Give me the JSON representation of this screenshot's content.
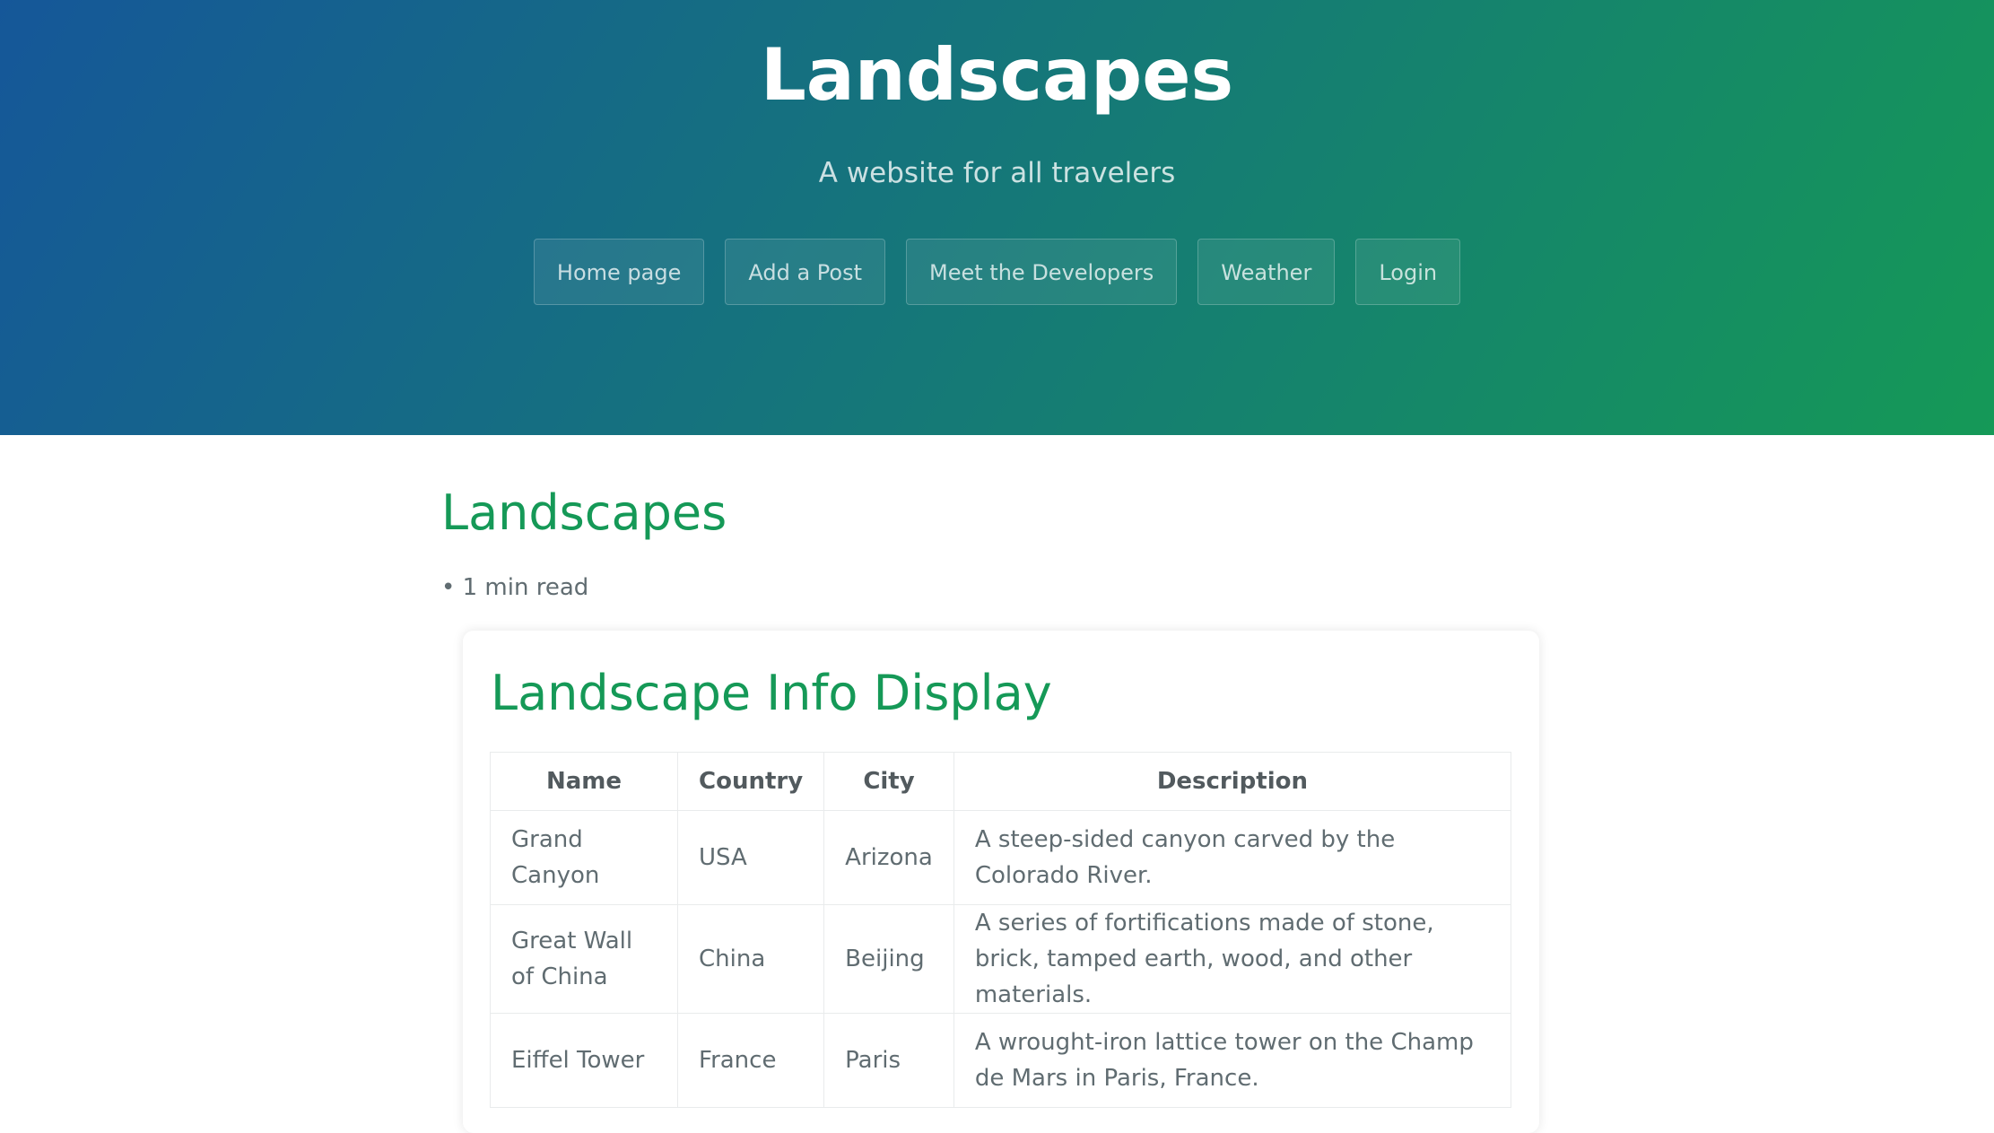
{
  "header": {
    "title": "Landscapes",
    "tagline": "A website for all travelers",
    "nav": [
      {
        "label": "Home page"
      },
      {
        "label": "Add a Post"
      },
      {
        "label": "Meet the Developers"
      },
      {
        "label": "Weather"
      },
      {
        "label": "Login"
      }
    ]
  },
  "post": {
    "title": "Landscapes",
    "meta": "• 1 min read"
  },
  "card": {
    "title": "Landscape Info Display",
    "table": {
      "headers": [
        "Name",
        "Country",
        "City",
        "Description"
      ],
      "rows": [
        [
          "Grand Canyon",
          "USA",
          "Arizona",
          "A steep-sided canyon carved by the Colorado River."
        ],
        [
          "Great Wall of China",
          "China",
          "Beijing",
          "A series of fortifications made of stone, brick, tamped earth, wood, and other materials."
        ],
        [
          "Eiffel Tower",
          "France",
          "Paris",
          "A wrought-iron lattice tower on the Champ de Mars in Paris, France."
        ]
      ]
    }
  },
  "colors": {
    "gradient_start": "#155799",
    "gradient_end": "#159957",
    "heading": "#159957",
    "text": "#606c71"
  }
}
